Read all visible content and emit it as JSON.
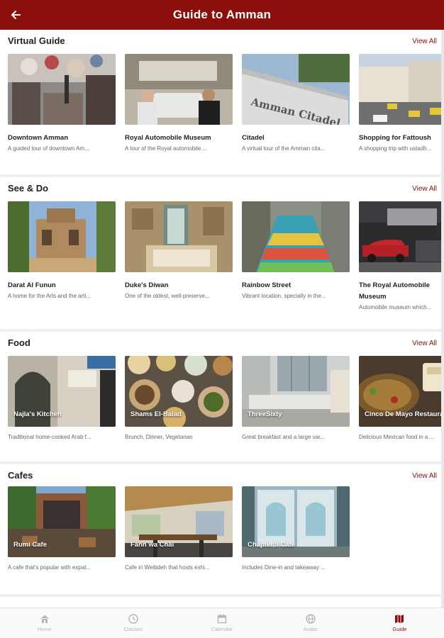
{
  "header": {
    "title": "Guide to Amman",
    "back_icon": "arrow-left-icon"
  },
  "colors": {
    "brand": "#8b0f0a",
    "inactive": "#b5b5b5"
  },
  "sections": [
    {
      "title": "Virtual Guide",
      "view_all": "View All",
      "cards": [
        {
          "title": "Downtown Amman",
          "subtitle": "A guided tour of downtown Am..."
        },
        {
          "title": "Royal Automobile Museum",
          "subtitle": "A tour of the Royal automobile ..."
        },
        {
          "title": "Citadel",
          "subtitle": "A virtual tour of the Amman cita...",
          "image_text": "Amman Citadel"
        },
        {
          "title": "Shopping for Fattoush",
          "subtitle": "A shopping trip with ustadh..."
        }
      ]
    },
    {
      "title": "See & Do",
      "view_all": "View All",
      "cards": [
        {
          "title": "Darat Al Funun",
          "subtitle": "A home for the Arts and the arti..."
        },
        {
          "title": "Duke's Diwan",
          "subtitle": "One of the oldest, well-preserve..."
        },
        {
          "title": "Rainbow Street",
          "subtitle": "Vibrant location, specially in the..."
        },
        {
          "title": "The Royal Automobile Museum",
          "subtitle": "Automobile museum which..."
        }
      ]
    },
    {
      "title": "Food",
      "view_all": "View All",
      "cards": [
        {
          "title": "Najla's Kitchen",
          "subtitle": "Traditional home-cooked Arab f..."
        },
        {
          "title": "Shams El-Balad",
          "subtitle": "Brunch, Dinner, Vegetarian"
        },
        {
          "title": "ThreeSixty",
          "subtitle": "Great breakfast and a large var..."
        },
        {
          "title": "Cinco De Mayo Restaurant",
          "subtitle": "Delicious Mexican food in a ..."
        }
      ]
    },
    {
      "title": "Cafes",
      "view_all": "View All",
      "cards": [
        {
          "title": "Rumi Cafe",
          "subtitle": "A cafe that's popular with expat..."
        },
        {
          "title": "Fann wa Chai",
          "subtitle": "Cafe in Weibdeh that hosts exhi..."
        },
        {
          "title": "Chapter 9 Cafe",
          "subtitle": "Includes Dine-in and takeaway ..."
        }
      ]
    }
  ],
  "bottom_nav": [
    {
      "label": "Home",
      "icon": "home-icon",
      "active": false
    },
    {
      "label": "Classes",
      "icon": "clock-icon",
      "active": false
    },
    {
      "label": "Calendar",
      "icon": "calendar-icon",
      "active": false
    },
    {
      "label": "Arabic",
      "icon": "globe-icon",
      "active": false
    },
    {
      "label": "Guide",
      "icon": "map-icon",
      "active": true
    }
  ]
}
